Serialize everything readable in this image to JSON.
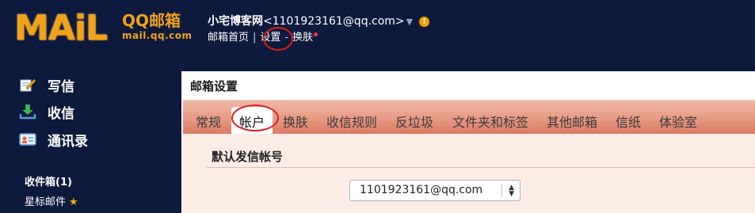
{
  "logo": {
    "mail_word": "MAiL",
    "brand": "QQ邮箱",
    "domain": "mail.qq.com"
  },
  "header": {
    "user_name": "小宅博客网",
    "user_email": "<1101923161@qq.com>",
    "alert_symbol": "!",
    "nav": {
      "home": "邮箱首页",
      "settings": "设置",
      "skin": "换肤"
    }
  },
  "sidebar": {
    "write": "写信",
    "inbox": "收信",
    "contacts": "通讯录",
    "folders": {
      "inbox": "收件箱(1)",
      "starred": "星标邮件"
    }
  },
  "main": {
    "title": "邮箱设置",
    "tabs": [
      "常规",
      "帐户",
      "换肤",
      "收信规则",
      "反垃圾",
      "文件夹和标签",
      "其他邮箱",
      "信纸",
      "体验室"
    ],
    "active_tab": "帐户",
    "section_title": "默认发信帐号",
    "sender_select_value": "1101923161@qq.com"
  },
  "icons": {
    "write": "pencil-note-icon",
    "inbox": "download-tray-icon",
    "contacts": "address-card-icon",
    "star": "star-icon",
    "caret": "triangle-down-icon",
    "select_arrows": "up-down-arrows-icon"
  },
  "colors": {
    "header_bg": "#0d1a3d",
    "logo_gold": "#f2a11b",
    "tabbar": "#e79a83",
    "content_bg": "#fbece6",
    "annotation_red": "#e11a1a",
    "alert_orange": "#f5a000"
  }
}
